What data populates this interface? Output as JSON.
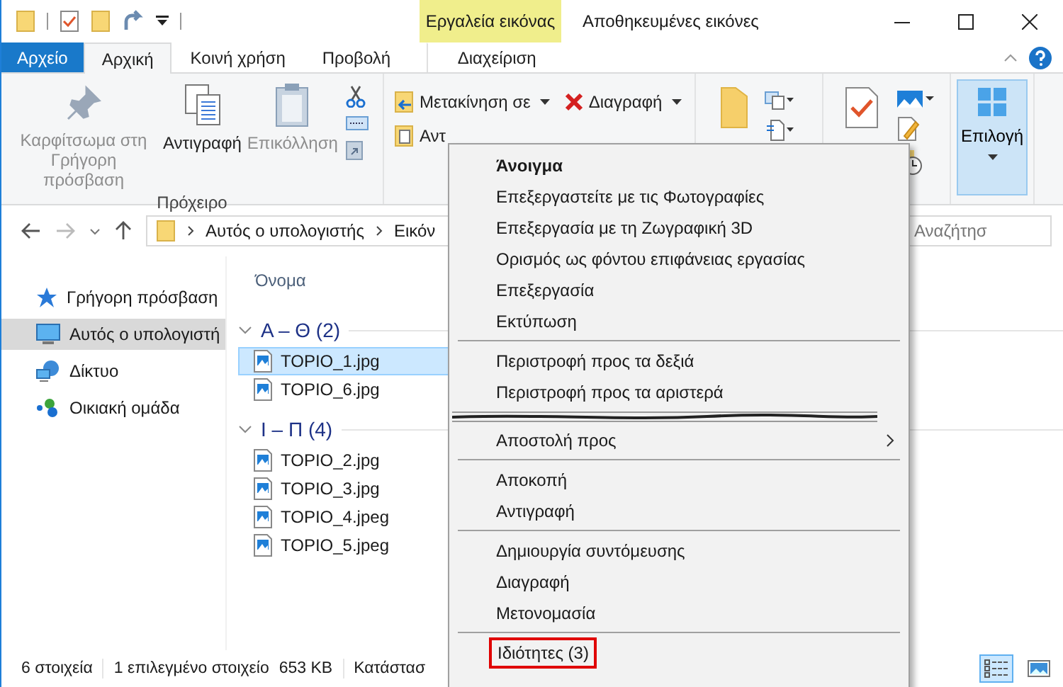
{
  "contextual_tab_group": {
    "label": "Εργαλεία εικόνας"
  },
  "window": {
    "title": "Αποθηκευμένες εικόνες"
  },
  "tabs": [
    {
      "label": "Αρχείο",
      "kind": "file",
      "selected": false
    },
    {
      "label": "Αρχική",
      "kind": "tab",
      "selected": true
    },
    {
      "label": "Κοινή χρήση",
      "kind": "tab",
      "selected": false
    },
    {
      "label": "Προβολή",
      "kind": "tab",
      "selected": false
    },
    {
      "label": "Διαχείριση",
      "kind": "contextual",
      "selected": false
    }
  ],
  "ribbon": {
    "clipboard": {
      "buttons": [
        {
          "label": "Καρφίτσωμα στη Γρήγορη πρόσβαση",
          "disabled": true
        },
        {
          "label": "Αντιγραφή",
          "disabled": false
        },
        {
          "label": "Επικόλληση",
          "disabled": true
        }
      ],
      "group_label": "Πρόχειρο"
    },
    "organize": [
      {
        "label": "Μετακίνηση σε",
        "dropdown": true
      },
      {
        "label": "Αντ",
        "dropdown": false
      },
      {
        "label": "Διαγραφή",
        "dropdown": true
      }
    ],
    "select": {
      "label": "Επιλογή",
      "selected": true
    }
  },
  "address": {
    "breadcrumbs": [
      "Αυτός ο υπολογιστής",
      "Εικόν"
    ],
    "search_placeholder": "Αναζήτησ"
  },
  "sidebar": {
    "items": [
      {
        "label": "Γρήγορη πρόσβαση",
        "selected": false
      },
      {
        "label": "Αυτός ο υπολογιστή",
        "selected": true
      },
      {
        "label": "Δίκτυο",
        "selected": false
      },
      {
        "label": "Οικιακή ομάδα",
        "selected": false
      }
    ]
  },
  "file_list": {
    "column": "Όνομα",
    "groups": [
      {
        "label": "Α – Θ (2)",
        "expanded": true,
        "files": [
          {
            "name": "TOPIO_1.jpg",
            "selected": true
          },
          {
            "name": "TOPIO_6.jpg",
            "selected": false
          }
        ]
      },
      {
        "label": "Ι – Π (4)",
        "expanded": true,
        "files": [
          {
            "name": "TOPIO_2.jpg",
            "selected": false
          },
          {
            "name": "TOPIO_3.jpg",
            "selected": false
          },
          {
            "name": "TOPIO_4.jpeg",
            "selected": false
          },
          {
            "name": "TOPIO_5.jpeg",
            "selected": false
          }
        ]
      }
    ]
  },
  "status_bar": {
    "item_count": "6 στοιχεία",
    "selection": "1 επιλεγμένο στοιχείο",
    "size": "653 KB",
    "column_3": "Κατάστασ"
  },
  "view_buttons": [
    {
      "kind": "details",
      "selected": true
    },
    {
      "kind": "thumbnails",
      "selected": false
    }
  ],
  "context_menu": {
    "items": [
      {
        "kind": "default",
        "label": "Άνοιγμα"
      },
      {
        "kind": "item",
        "label": "Επεξεργαστείτε με τις Φωτογραφίες"
      },
      {
        "kind": "item",
        "label": "Επεξεργασία με τη Ζωγραφική 3D"
      },
      {
        "kind": "item",
        "label": "Ορισμός ως φόντου επιφάνειας εργασίας"
      },
      {
        "kind": "item",
        "label": "Επεξεργασία"
      },
      {
        "kind": "item",
        "label": "Εκτύπωση"
      },
      {
        "kind": "separator"
      },
      {
        "kind": "item",
        "label": "Περιστροφή προς τα δεξιά"
      },
      {
        "kind": "item",
        "label": "Περιστροφή προς τα αριστερά"
      },
      {
        "kind": "torn"
      },
      {
        "kind": "submenu",
        "label": "Αποστολή προς"
      },
      {
        "kind": "separator"
      },
      {
        "kind": "item",
        "label": "Αποκοπή"
      },
      {
        "kind": "item",
        "label": "Αντιγραφή"
      },
      {
        "kind": "separator"
      },
      {
        "kind": "item",
        "label": "Δημιουργία συντόμευσης"
      },
      {
        "kind": "item",
        "label": "Διαγραφή"
      },
      {
        "kind": "item",
        "label": "Μετονομασία"
      },
      {
        "kind": "separator"
      },
      {
        "kind": "item",
        "label": "Ιδιότητες (3)",
        "outlined": true
      }
    ]
  }
}
